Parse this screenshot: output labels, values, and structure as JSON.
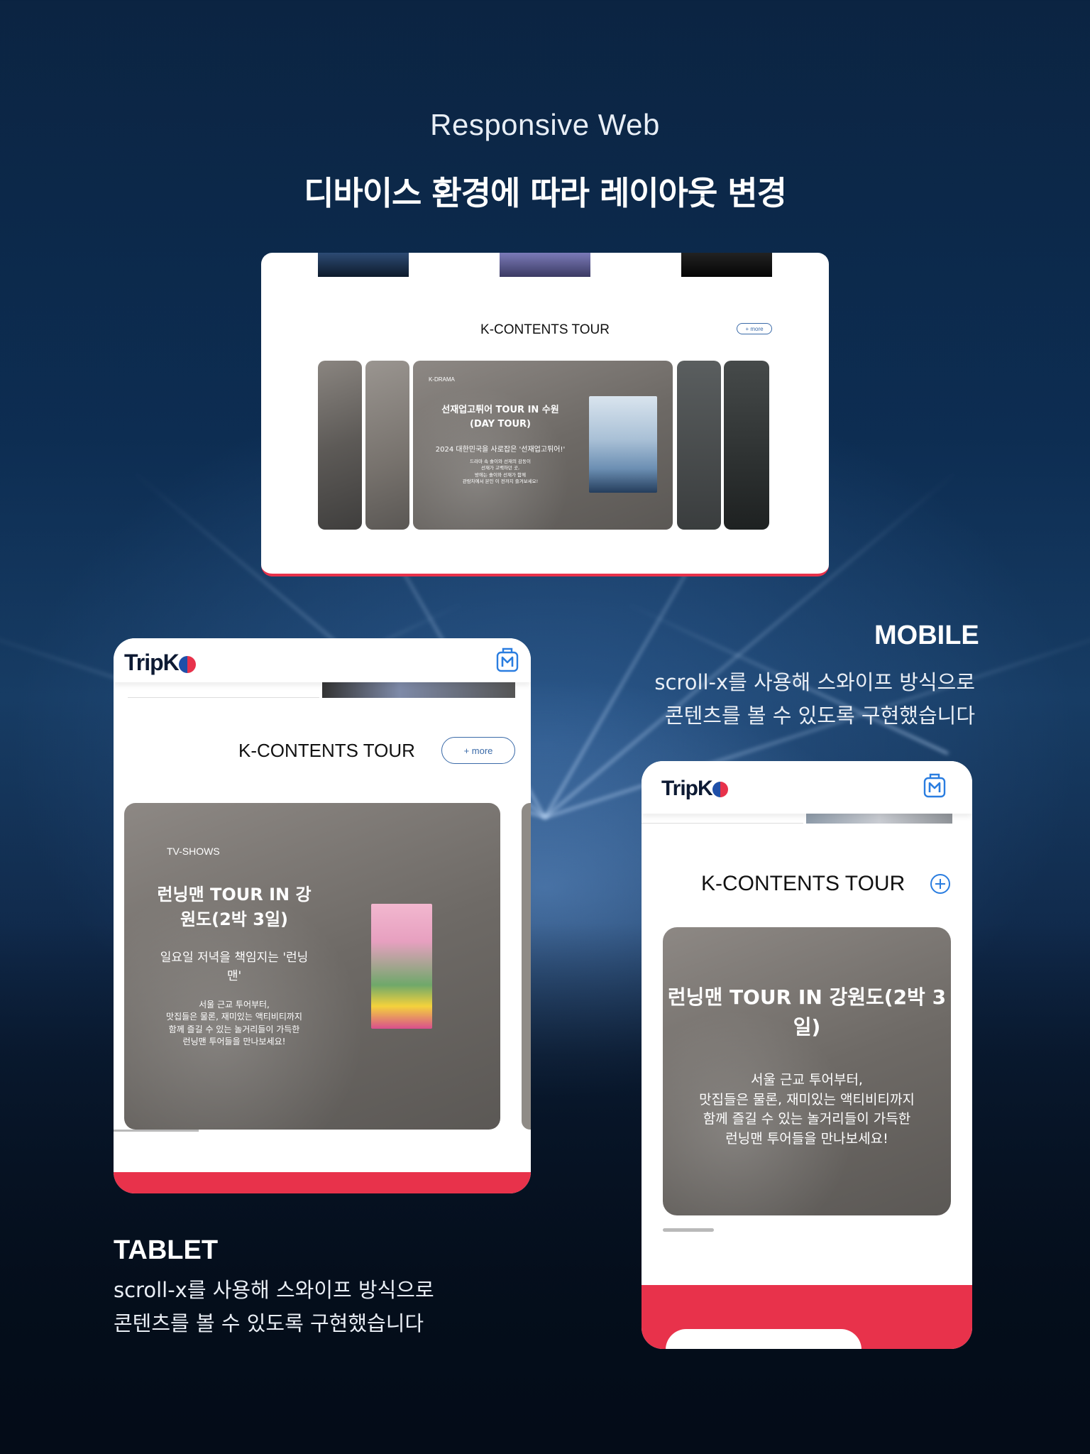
{
  "page": {
    "subtitle": "Responsive Web",
    "title": "디바이스 환경에 따라 레이아웃 변경"
  },
  "desktop": {
    "section_title": "K-CONTENTS TOUR",
    "more_label": "+ more",
    "card": {
      "category": "K-DRAMA",
      "title_line1": "선재업고튀어 TOUR IN 수원",
      "title_line2": "(DAY TOUR)",
      "subtitle": "2024 대한민국을 사로잡은 '선재업고튀어!'",
      "desc": [
        "드라마 속 솔이와 선재의 감동이",
        "선재가 고백하던 곳,",
        "방에는 솔이와 선재가 함께",
        "관람차에서 본인 이 전까지 즐겨보세요!"
      ]
    }
  },
  "tablet": {
    "logo_prefix": "Trip",
    "logo_k": "K",
    "section_title": "K-CONTENTS TOUR",
    "more_label": "+ more",
    "card": {
      "category": "TV-SHOWS",
      "title_line1": "런닝맨 TOUR IN 강",
      "title_line2": "원도(2박 3일)",
      "subtitle_line1": "일요일 저녁을 책임지는 '런닝",
      "subtitle_line2": "맨'",
      "desc": [
        "서울 근교 투어부터,",
        "맛집들은 물론, 재미있는 액티비티까지",
        "함께 즐길 수 있는 놀거리들이 가득한",
        "런닝맨 투어들을 만나보세요!"
      ]
    },
    "label": "TABLET",
    "label_desc": [
      "scroll-x를 사용해 스와이프 방식으로",
      "콘텐츠를 볼 수 있도록 구현했습니다"
    ]
  },
  "mobile": {
    "logo_prefix": "Trip",
    "logo_k": "K",
    "section_title": "K-CONTENTS TOUR",
    "card": {
      "title_line1": "런닝맨 TOUR IN 강원도(2박 3",
      "title_line2": "일)",
      "desc": [
        "서울 근교 투어부터,",
        "맛집들은 물론, 재미있는 액티비티까지",
        "함께 즐길 수 있는 놀거리들이 가득한",
        "런닝맨 투어들을 만나보세요!"
      ]
    },
    "label": "MOBILE",
    "label_desc": [
      "scroll-x를 사용해 스와이프 방식으로",
      "콘텐츠를 볼 수 있도록 구현했습니다"
    ]
  },
  "colors": {
    "accent_red": "#e8324b",
    "accent_blue": "#3a6aa8",
    "navy": "#0d1a33"
  },
  "icons": [
    "menu-suitcase-icon",
    "plus-circle-icon",
    "plane-icon"
  ]
}
